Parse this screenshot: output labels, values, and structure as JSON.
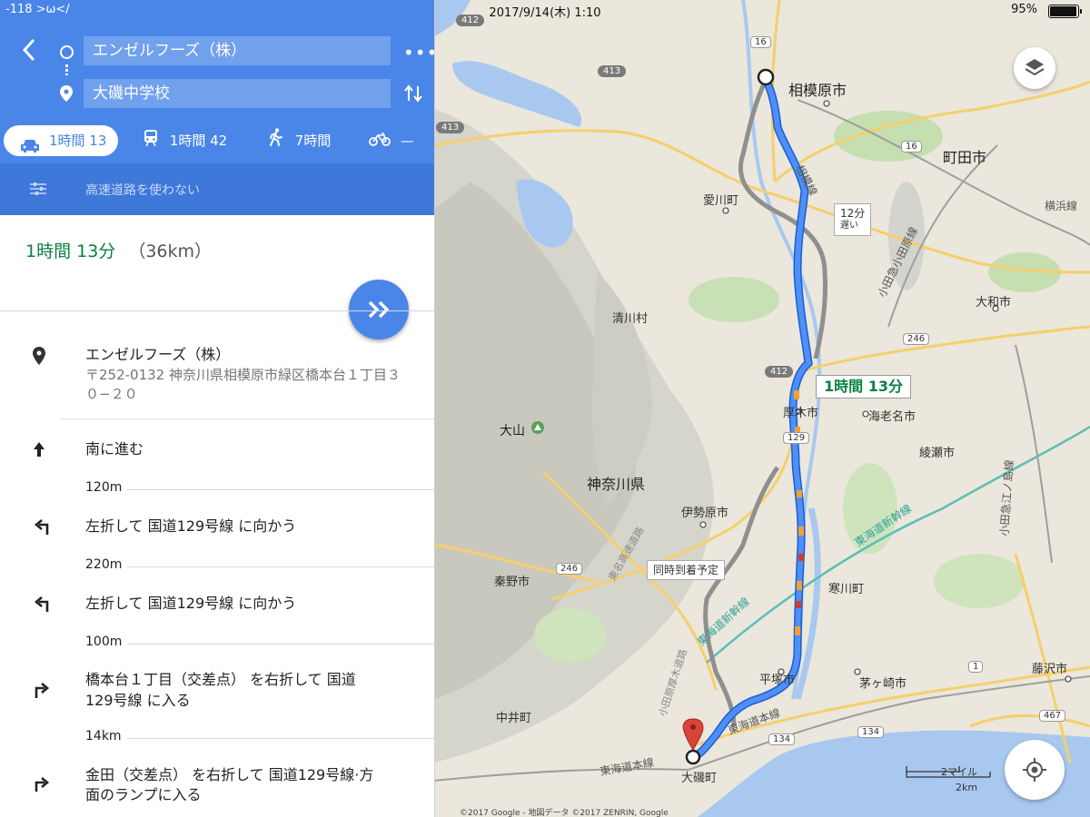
{
  "status": {
    "signal": "-118 >ω</ ",
    "time": "2017/9/14(木) 1:10",
    "battery": "95%"
  },
  "route": {
    "from": "エンゼルフーズ（株）",
    "to": "大磯中学校",
    "more_label": "•••"
  },
  "modes": {
    "car": "1時間 13",
    "train": "1時間 42",
    "walk": "7時間",
    "bike": "—"
  },
  "options": {
    "avoid_highways": "高速道路を使わない"
  },
  "summary": {
    "duration": "1時間 13分",
    "distance": "（36km）"
  },
  "directions": {
    "origin_name": "エンゼルフーズ（株）",
    "origin_address_1": "〒252-0132 神奈川県相模原市緑区橋本台１丁目３",
    "origin_address_2": "０−２０",
    "steps": [
      {
        "text": "南に進む",
        "distance": "120m"
      },
      {
        "text": "左折して 国道129号線 に向かう",
        "distance": "220m"
      },
      {
        "text": "左折して 国道129号線 に向かう",
        "distance": "100m"
      },
      {
        "text_1": "橋本台１丁目（交差点） を右折して 国道",
        "text_2": "129号線 に入る",
        "distance": "14km"
      },
      {
        "text_1": "金田（交差点） を右折して 国道129号線·方",
        "text_2": "面のランプに入る"
      }
    ]
  },
  "map": {
    "cities": {
      "sagamihara": "相模原市",
      "machida": "町田市",
      "aikawa": "愛川町",
      "kiyokawa": "清川村",
      "yamato": "大和市",
      "atsugi": "厚木市",
      "ebina": "海老名市",
      "ayase": "綾瀬市",
      "isehara": "伊勢原市",
      "hadano": "秦野市",
      "samukawa": "寒川町",
      "hiratsuka": "平塚市",
      "chigasaki": "茅ヶ崎市",
      "fujisawa": "藤沢市",
      "nakai": "中井町",
      "oiso": "大磯町",
      "kanagawa": "神奈川県",
      "oyama": "大山"
    },
    "lines": {
      "sagami_line": "相模線",
      "yokohama_line": "横浜線",
      "odakyu_odawara": "小田急小田原線",
      "tokaido_shinkansen_1": "東海道新幹線",
      "tokaido_shinkansen_2": "東海道新幹線",
      "tokaido_main_1": "東海道本線",
      "tokaido_main_2": "東海道本線",
      "odakyu_enoshima": "小田急江ノ島線",
      "tomei": "東名高速道路",
      "odawara_atsugi": "小田原厚木道路"
    },
    "shields": [
      "412",
      "413",
      "413",
      "16",
      "16",
      "246",
      "412",
      "129",
      "246",
      "1",
      "467",
      "134",
      "134"
    ],
    "callouts": {
      "alt_time": "12分",
      "alt_note": "遅い",
      "main_time": "1時間 13分",
      "same_arrival": "同時到着予定"
    },
    "scale": {
      "miles": "2マイル",
      "km": "2km"
    },
    "copyright": "©2017 Google - 地図データ ©2017 ZENRIN, Google"
  },
  "colors": {
    "header": "#4a86e8",
    "route": "#4285f4",
    "duration_green": "#0b8043"
  }
}
